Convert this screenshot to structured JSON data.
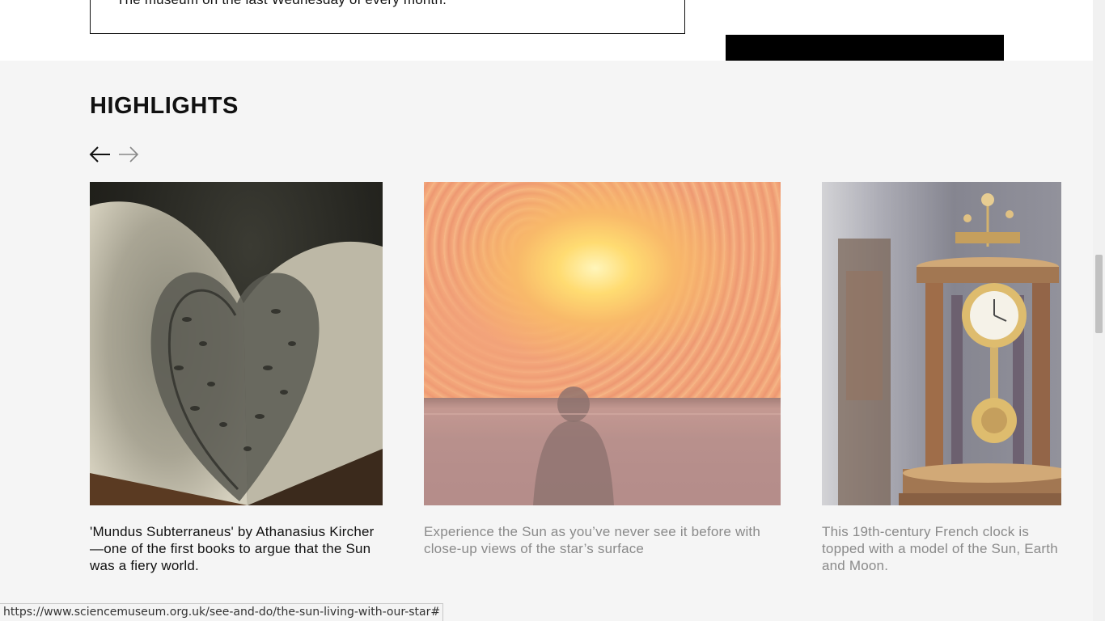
{
  "info_box": {
    "text": "The museum on the last Wednesday of every month."
  },
  "highlights": {
    "title": "HIGHLIGHTS",
    "prev_icon": "arrow-left-icon",
    "next_icon": "arrow-right-icon",
    "cards": [
      {
        "image": "book-heart-pages-image",
        "caption": "'Mundus Subterraneus' by Athanasius Kircher—one of the first books to argue that the Sun was a fiery world."
      },
      {
        "image": "sun-surface-image",
        "caption": "Experience the Sun as you’ve never see it before with close-up views of the star’s surface"
      },
      {
        "image": "french-clock-image",
        "caption": "This 19th-century French clock is topped with a model of the Sun, Earth and Moon."
      }
    ]
  },
  "status_bar": {
    "url": "https://www.sciencemuseum.org.uk/see-and-do/the-sun-living-with-our-star#"
  },
  "colors": {
    "section_background": "#f5f5f5",
    "text_primary": "#111111",
    "text_muted": "#8a8a8a",
    "button_black": "#000000"
  }
}
